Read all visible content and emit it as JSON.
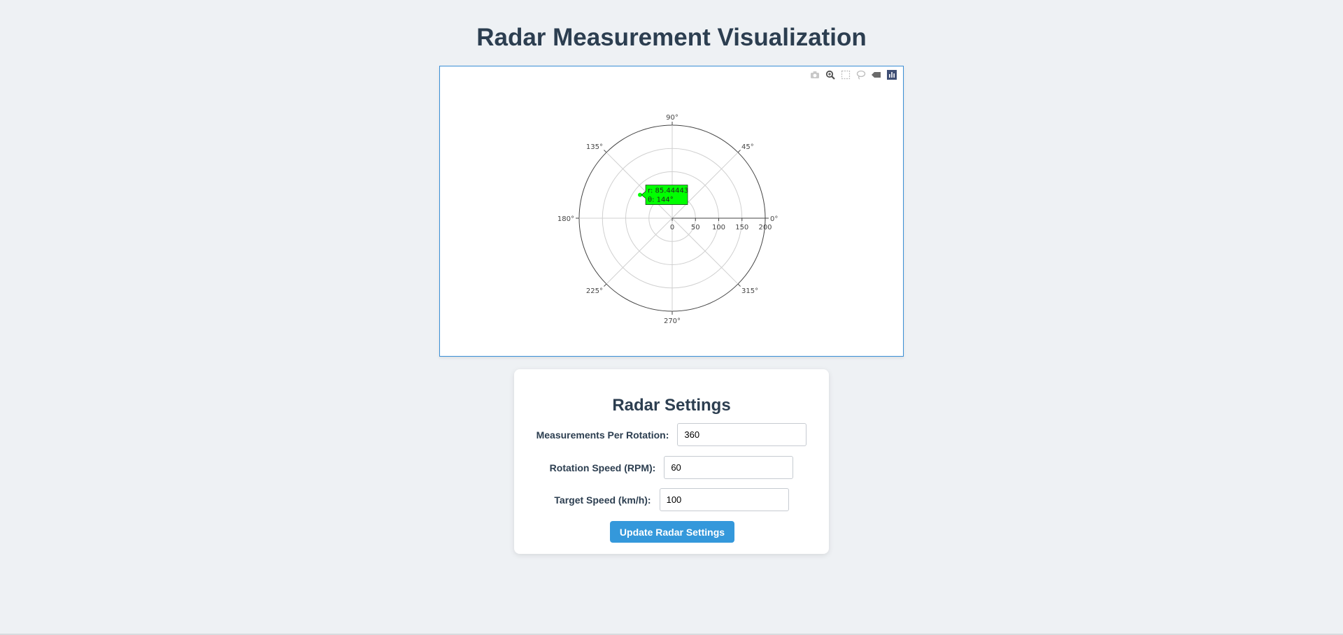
{
  "page": {
    "title": "Radar Measurement Visualization"
  },
  "modebar": {
    "icons": [
      "camera-icon",
      "zoom-icon",
      "box-select-icon",
      "lasso-select-icon",
      "autoscale-icon",
      "plotly-logo-icon"
    ]
  },
  "chart_data": {
    "type": "scatter",
    "subtype": "polar",
    "radial_axis": {
      "range": [
        0,
        200
      ],
      "ticks": [
        "0",
        "50",
        "100",
        "150",
        "200"
      ]
    },
    "angular_axis": {
      "ticks": [
        "0°",
        "45°",
        "90°",
        "135°",
        "180°",
        "225°",
        "270°",
        "315°"
      ],
      "direction": "counterclockwise"
    },
    "series": [
      {
        "points": [
          {
            "r": 85.44443,
            "theta": 144
          }
        ],
        "color": "#00ff00"
      }
    ],
    "tooltip": {
      "line1": "r: 85.44443",
      "line2": "θ: 144°",
      "background": "#00ff00"
    },
    "grid": true
  },
  "settings": {
    "title": "Radar Settings",
    "measurements_label": "Measurements Per Rotation:",
    "measurements_value": "360",
    "rotation_label": "Rotation Speed (RPM):",
    "rotation_value": "60",
    "target_label": "Target Speed (km/h):",
    "target_value": "100",
    "update_button": "Update Radar Settings"
  }
}
